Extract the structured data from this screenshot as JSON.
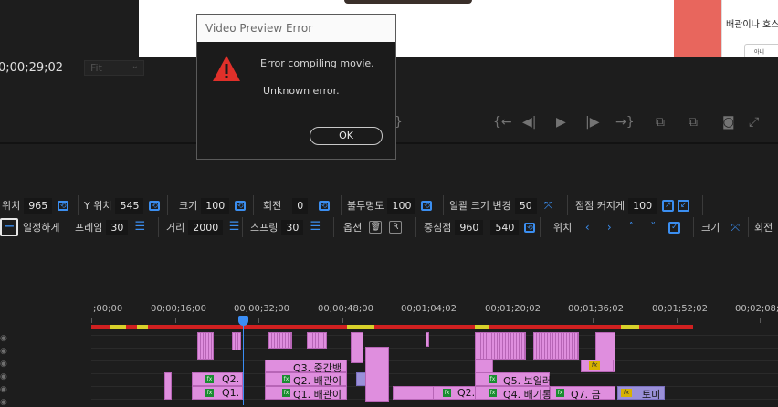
{
  "preview": {
    "side_text": "배관이나 호스",
    "side_button": "아니"
  },
  "monitor": {
    "timecode": "0;00;29;02",
    "fit_label": "Fit",
    "transport_icons": [
      "step-back-icon",
      "play-back-icon",
      "play-icon",
      "play-forward-icon",
      "step-forward-icon",
      "insert-icon",
      "overwrite-icon",
      "camera-icon",
      "fullscreen-icon"
    ]
  },
  "props_row1": [
    {
      "label": "위치",
      "value": "965",
      "icon": "link"
    },
    {
      "label": "Y 위치",
      "value": "545",
      "icon": "link"
    },
    {
      "label": "크기",
      "value": "100",
      "icon": "link"
    },
    {
      "label": "회전",
      "value": "0",
      "icon": "link"
    },
    {
      "label": "불투명도",
      "value": "100",
      "icon": "link"
    },
    {
      "label": "일괄 크기 변경",
      "value": "50",
      "icon": "expand"
    },
    {
      "label": "점점 커지게",
      "value": "100",
      "icon": "boxes"
    }
  ],
  "props_row2": {
    "consistent": "일정하게",
    "frame_label": "프레임",
    "frame_value": "30",
    "distance_label": "거리",
    "distance_value": "2000",
    "spring_label": "스프링",
    "spring_value": "30",
    "options_label": "옵션",
    "r_label": "R",
    "center_label": "중심점",
    "center_x": "960",
    "center_y": "540",
    "position_label": "위치",
    "size_label": "크기",
    "rotate_label": "회전"
  },
  "timeline": {
    "ruler": [
      ";00;00",
      "00;00;16;00",
      "00;00;32;00",
      "00;00;48;00",
      "00;01;04;02",
      "00;01;20;02",
      "00;01;36;02",
      "00;01;52;02",
      "00;02;08;0"
    ],
    "clip_labels": {
      "q3": "Q3. 중간뱅",
      "q2a": "Q2. 배관이",
      "q1a": "Q1. 배관이",
      "q2b": "Q2.",
      "q1b": "Q1.",
      "q2c": "Q2.",
      "q5": "Q5. 보일러",
      "q4": "Q4. 배기통",
      "q7": "Q7. 금",
      "tomi": "토미",
      "fx": "fx"
    }
  },
  "dialog": {
    "title": "Video Preview Error",
    "message1": "Error compiling movie.",
    "message2": "Unknown error.",
    "ok_label": "OK"
  },
  "colors": {
    "accent": "#3b8ef0",
    "clip": "#df8ede",
    "warning": "#e0302a",
    "workbar": "#d02020"
  }
}
